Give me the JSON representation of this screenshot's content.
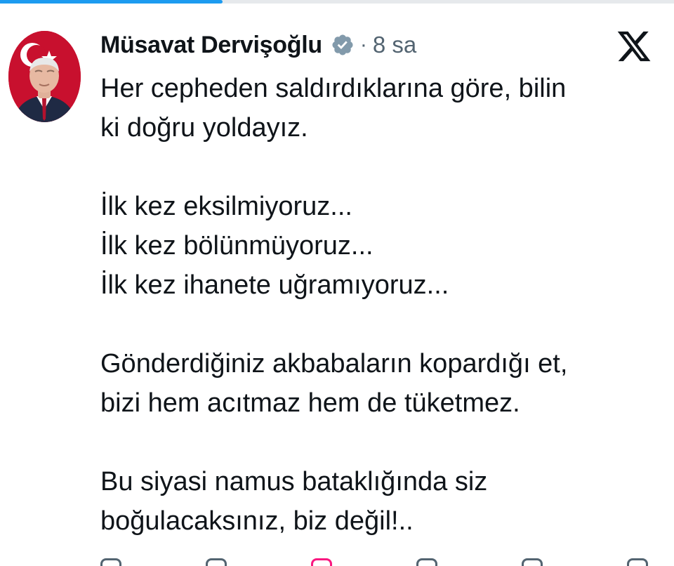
{
  "page": {
    "progress_fraction": 0.33,
    "progress_color": "#1d9bf0"
  },
  "tweet": {
    "author_name": "Müsavat Dervişoğlu",
    "verified": true,
    "verified_badge_color": "#829aab",
    "separator": "·",
    "time": "8 sa",
    "platform_icon": "x-logo-icon",
    "avatar_icon": "profile-photo-avatar",
    "lines": [
      "Her cepheden saldırdıklarına göre, bilin",
      "ki doğru yoldayız.",
      "",
      "İlk kez eksilmiyoruz...",
      "İlk kez bölünmüyoruz...",
      "İlk kez ihanete uğramıyoruz...",
      "",
      "Gönderdiğiniz akbabaların kopardığı et,",
      "bizi hem acıtmaz hem de tüketmez.",
      "",
      "Bu siyasi namus bataklığında siz",
      "boğulacaksınız, biz değil!.."
    ],
    "actions": [
      "reply-icon",
      "repost-icon",
      "like-icon",
      "views-icon",
      "bookmark-icon",
      "share-icon"
    ]
  }
}
